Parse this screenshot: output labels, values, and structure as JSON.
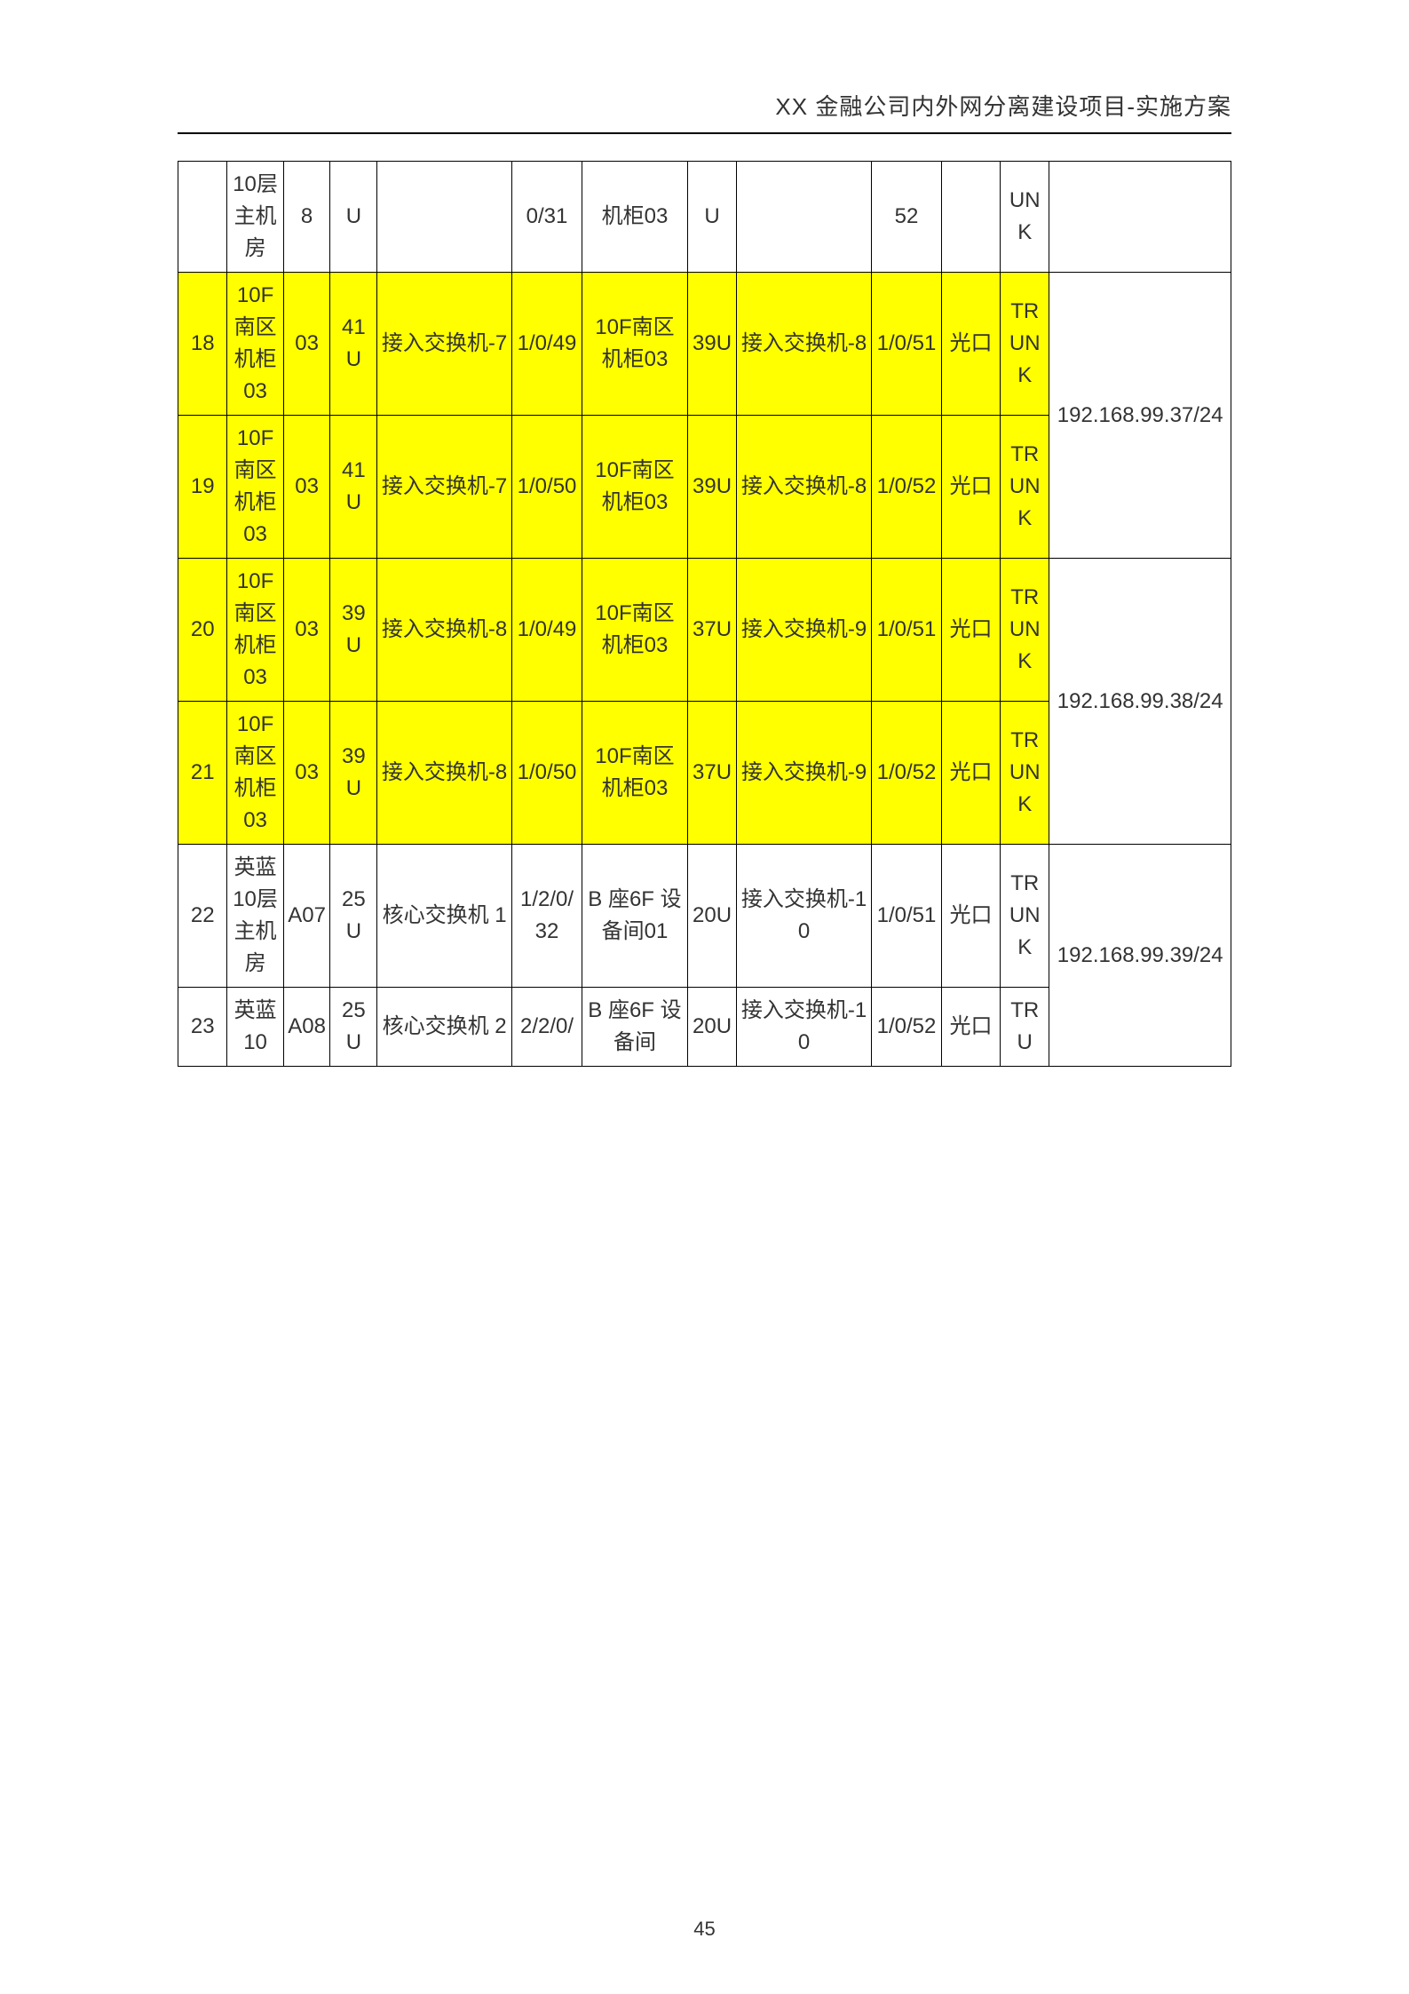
{
  "header": {
    "title": "XX 金融公司内外网分离建设项目-实施方案"
  },
  "footer": {
    "page": "45"
  },
  "rows": [
    {
      "c1": "",
      "c2": "10层主机房",
      "c3": "8",
      "c4": "U",
      "c5": "",
      "c6": "0/31",
      "c7": "机柜03",
      "c8": "U",
      "c9": "",
      "c10": "52",
      "c11": "",
      "c12": "UNK",
      "c13": "",
      "hl": false
    },
    {
      "c1": "18",
      "c2": "10F南区机柜03",
      "c3": "03",
      "c4": "41U",
      "c5": "接入交换机-7",
      "c6": "1/0/49",
      "c7": "10F南区机柜03",
      "c8": "39U",
      "c9": "接入交换机-8",
      "c10": "1/0/51",
      "c11": "光口",
      "c12": "TRUNK",
      "c13_merge": true,
      "hl": true
    },
    {
      "c1": "19",
      "c2": "10F南区机柜03",
      "c3": "03",
      "c4": "41U",
      "c5": "接入交换机-7",
      "c6": "1/0/50",
      "c7": "10F南区机柜03",
      "c8": "39U",
      "c9": "接入交换机-8",
      "c10": "1/0/52",
      "c11": "光口",
      "c12": "TRUNK",
      "c13": "192.168.99.37/24",
      "hl": true
    },
    {
      "c1": "20",
      "c2": "10F南区机柜03",
      "c3": "03",
      "c4": "39U",
      "c5": "接入交换机-8",
      "c6": "1/0/49",
      "c7": "10F南区机柜03",
      "c8": "37U",
      "c9": "接入交换机-9",
      "c10": "1/0/51",
      "c11": "光口",
      "c12": "TRUNK",
      "c13_merge": true,
      "hl": true
    },
    {
      "c1": "21",
      "c2": "10F南区机柜03",
      "c3": "03",
      "c4": "39U",
      "c5": "接入交换机-8",
      "c6": "1/0/50",
      "c7": "10F南区机柜03",
      "c8": "37U",
      "c9": "接入交换机-9",
      "c10": "1/0/52",
      "c11": "光口",
      "c12": "TRUNK",
      "c13": "192.168.99.38/24",
      "hl": true
    },
    {
      "c1": "22",
      "c2": "英蓝10层主机房",
      "c3": "A07",
      "c4": "25U",
      "c5": "核心交换机 1",
      "c6": "1/2/0/32",
      "c7": "B 座6F 设备间01",
      "c8": "20U",
      "c9": "接入交换机-10",
      "c10": "1/0/51",
      "c11": "光口",
      "c12": "TRUNK",
      "c13_merge": true,
      "hl": false
    },
    {
      "c1": "23",
      "c2": "英蓝10",
      "c3": "A08",
      "c4": "25U",
      "c5": "核心交换机 2",
      "c6": "2/2/0/",
      "c7": "B 座6F 设备间",
      "c8": "20U",
      "c9": "接入交换机-10",
      "c10": "1/0/52",
      "c11": "光口",
      "c12": "TRU",
      "c13": "192.168.99.39/24",
      "hl": false
    }
  ]
}
